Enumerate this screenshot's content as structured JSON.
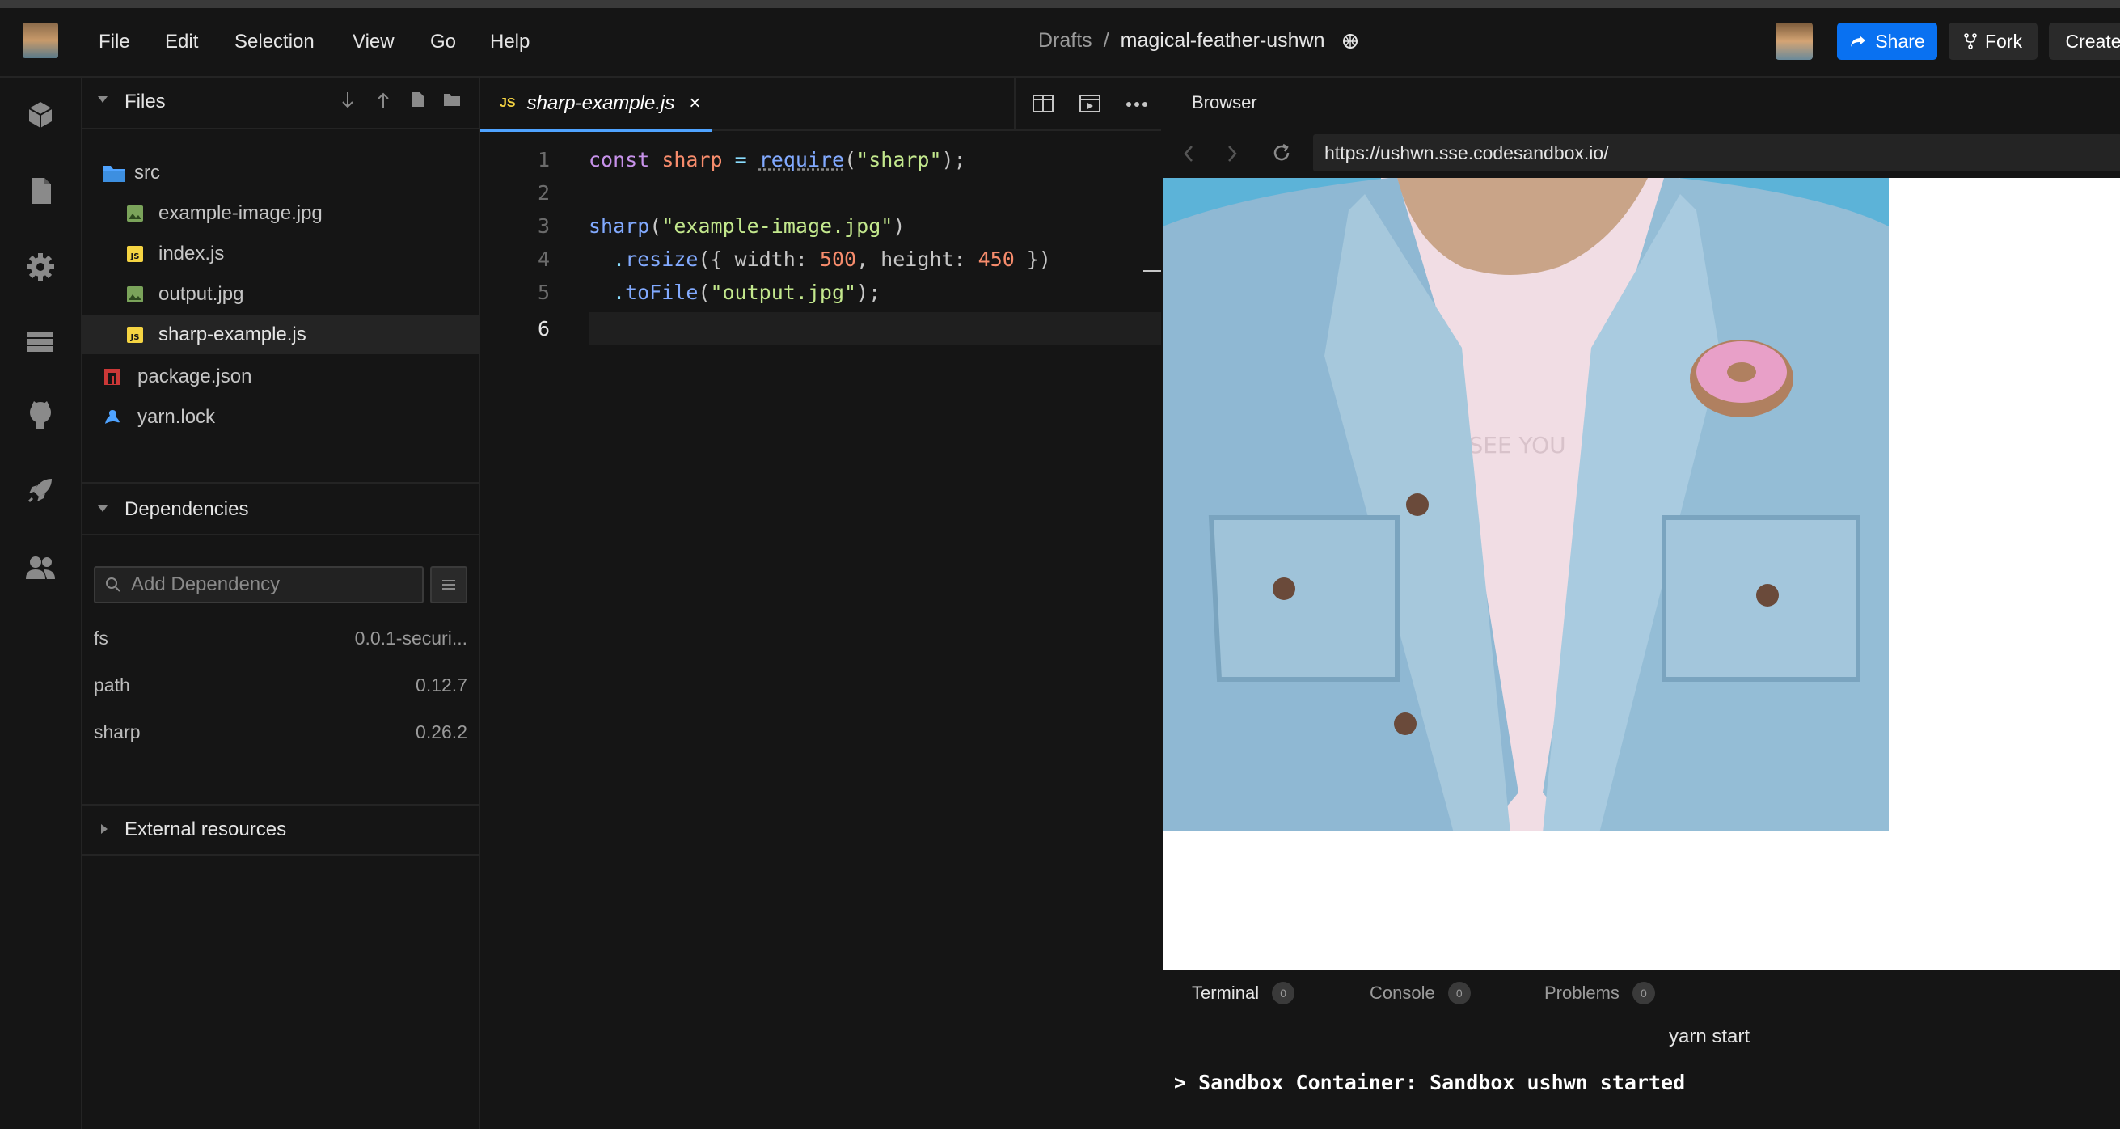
{
  "menu": [
    "File",
    "Edit",
    "Selection",
    "View",
    "Go",
    "Help"
  ],
  "breadcrumb": {
    "folder": "Drafts",
    "separator": "/",
    "sandbox": "magical-feather-ushwn"
  },
  "header": {
    "share": "Share",
    "fork": "Fork",
    "create": "Create"
  },
  "files": {
    "title": "Files",
    "items": [
      {
        "name": "src",
        "icon": "folder-icon"
      },
      {
        "name": "example-image.jpg",
        "icon": "image-file-icon"
      },
      {
        "name": "index.js",
        "icon": "js-file-icon"
      },
      {
        "name": "output.jpg",
        "icon": "image-file-icon"
      },
      {
        "name": "sharp-example.js",
        "icon": "js-file-icon"
      },
      {
        "name": "package.json",
        "icon": "npm-file-icon"
      },
      {
        "name": "yarn.lock",
        "icon": "yarn-file-icon"
      }
    ]
  },
  "dependencies": {
    "title": "Dependencies",
    "placeholder": "Add Dependency",
    "items": [
      {
        "name": "fs",
        "version": "0.0.1-securi..."
      },
      {
        "name": "path",
        "version": "0.12.7"
      },
      {
        "name": "sharp",
        "version": "0.26.2"
      }
    ]
  },
  "external": {
    "title": "External resources"
  },
  "editor": {
    "tab_badge": "JS",
    "tab_label": "sharp-example.js",
    "tab_close": "×",
    "line_numbers": [
      "1",
      "2",
      "3",
      "4",
      "5",
      "6"
    ],
    "code": {
      "l1": {
        "kw": "const",
        "var": "sharp",
        "eq": " = ",
        "fn": "require",
        "open": "(",
        "str": "\"sharp\"",
        "close": ");"
      },
      "l3": {
        "fn": "sharp",
        "open": "(",
        "str": "\"example-image.jpg\"",
        "close": ")"
      },
      "l4": {
        "dot": ".",
        "fn": "resize",
        "a": "({ ",
        "p1": "width",
        "c1": ": ",
        "n1": "500",
        "comma": ", ",
        "p2": "height",
        "c2": ": ",
        "n2": "450",
        "b": " })"
      },
      "l5": {
        "dot": ".",
        "fn": "toFile",
        "open": "(",
        "str": "\"output.jpg\"",
        "close": ");"
      }
    }
  },
  "browser": {
    "title": "Browser",
    "url": "https://ushwn.sse.codesandbox.io/",
    "photo_text": "I SEE YOU"
  },
  "terminal": {
    "tabs": [
      {
        "label": "Terminal",
        "count": "0"
      },
      {
        "label": "Console",
        "count": "0"
      },
      {
        "label": "Problems",
        "count": "0"
      }
    ],
    "command": "yarn start",
    "output": "> Sandbox Container: Sandbox ushwn started"
  },
  "colors": {
    "accent": "#0971f1",
    "background": "#151515",
    "tab_underline": "#4fa3ff"
  }
}
